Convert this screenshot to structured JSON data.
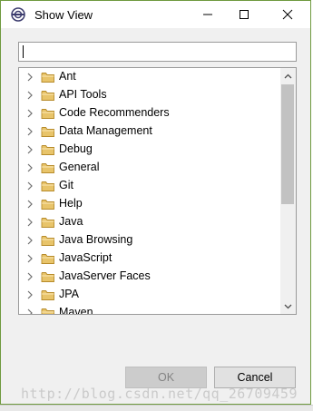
{
  "window": {
    "title": "Show View",
    "minimize_icon": "minimize-icon",
    "maximize_icon": "maximize-icon",
    "close_icon": "close-icon"
  },
  "filter": {
    "value": "",
    "placeholder": ""
  },
  "tree": {
    "items": [
      {
        "label": "Ant",
        "icon": "folder-icon"
      },
      {
        "label": "API Tools",
        "icon": "folder-icon"
      },
      {
        "label": "Code Recommenders",
        "icon": "folder-icon"
      },
      {
        "label": "Data Management",
        "icon": "folder-icon"
      },
      {
        "label": "Debug",
        "icon": "folder-icon"
      },
      {
        "label": "General",
        "icon": "folder-icon"
      },
      {
        "label": "Git",
        "icon": "folder-icon"
      },
      {
        "label": "Help",
        "icon": "folder-icon"
      },
      {
        "label": "Java",
        "icon": "folder-icon"
      },
      {
        "label": "Java Browsing",
        "icon": "folder-icon"
      },
      {
        "label": "JavaScript",
        "icon": "folder-icon"
      },
      {
        "label": "JavaServer Faces",
        "icon": "folder-icon"
      },
      {
        "label": "JPA",
        "icon": "folder-icon"
      },
      {
        "label": "Maven",
        "icon": "folder-icon"
      }
    ]
  },
  "buttons": {
    "ok": "OK",
    "cancel": "Cancel"
  },
  "watermark": "http://blog.csdn.net/qq_26709459",
  "colors": {
    "window_border": "#6f9a3f",
    "folder": "#e8c46a"
  }
}
